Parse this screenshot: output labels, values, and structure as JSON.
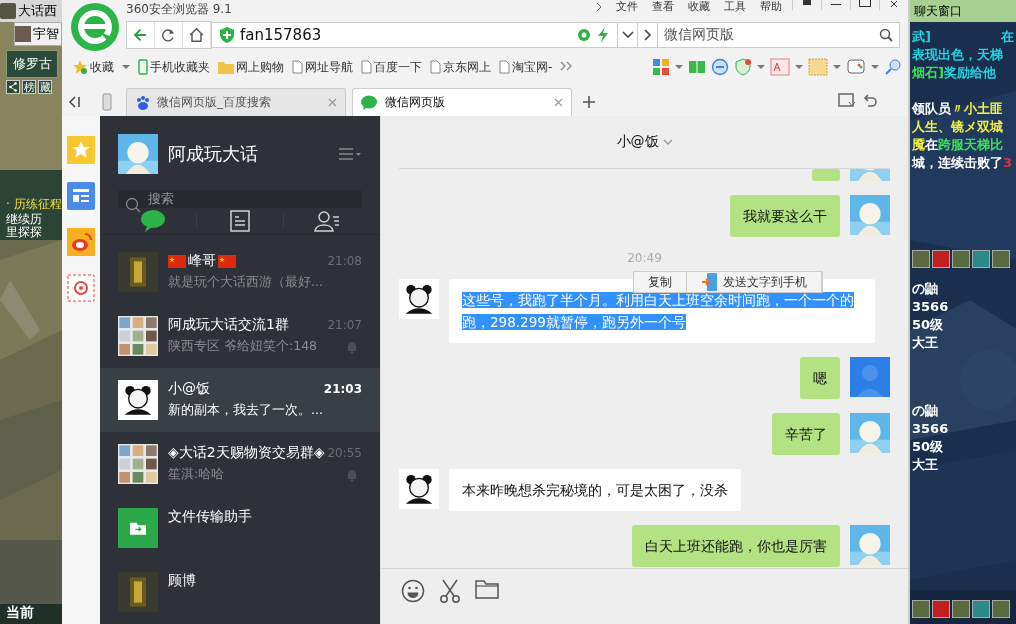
{
  "left_game": {
    "title": "大话西",
    "tab": "宇智",
    "banner": "修罗古",
    "tools": [
      "榜",
      "藏"
    ],
    "quest_title": "· 历练征程",
    "quest_lines": [
      "继续历",
      "里探探"
    ],
    "footer": "当前"
  },
  "browser": {
    "title": "360安全浏览器 9.1",
    "menu": [
      "文件",
      "查看",
      "收藏",
      "工具",
      "帮助"
    ],
    "address": "fan157863",
    "search": "微信网页版",
    "bookmarks": [
      {
        "label": "收藏",
        "kind": "favorites"
      },
      {
        "label": "手机收藏夹",
        "kind": "phone"
      },
      {
        "label": "网上购物",
        "kind": "folder"
      },
      {
        "label": "网址导航",
        "kind": "page"
      },
      {
        "label": "百度一下",
        "kind": "page"
      },
      {
        "label": "京东网上",
        "kind": "page"
      },
      {
        "label": "淘宝网-",
        "kind": "page"
      }
    ],
    "tabs": [
      {
        "label": "微信网页版_百度搜索",
        "selected": false,
        "kind": "baidu"
      },
      {
        "label": "微信网页版",
        "selected": true,
        "kind": "wechat"
      }
    ]
  },
  "wechat": {
    "user": "阿成玩大话",
    "search_placeholder": "搜索",
    "nav": [
      {
        "kind": "chat",
        "selected": true
      },
      {
        "kind": "articles",
        "selected": false
      },
      {
        "kind": "contacts",
        "selected": false
      }
    ],
    "chats": [
      {
        "name": "峰哥",
        "flags": true,
        "time": "21:08",
        "preview": "就是玩个大话西游（最好...",
        "selected": false,
        "muted": false
      },
      {
        "name": "阿成玩大话交流1群",
        "flags": false,
        "time": "21:07",
        "preview": "陕西专区 爷给妞笑个:148",
        "selected": false,
        "muted": true,
        "kind": "group"
      },
      {
        "name": "小@饭",
        "flags": false,
        "time": "21:03",
        "preview": "新的副本，我去了一次。...",
        "selected": true,
        "muted": false,
        "kind": "panda"
      },
      {
        "name": "◈大话2天赐物资交易群◈",
        "flags": false,
        "time": "20:55",
        "preview": "笙淇:哈哈",
        "selected": false,
        "muted": true,
        "kind": "group"
      },
      {
        "name": "文件传输助手",
        "flags": false,
        "selected": false,
        "muted": false,
        "kind": "file"
      },
      {
        "name": "顾博",
        "flags": false,
        "selected": false,
        "muted": false
      }
    ]
  },
  "chat": {
    "title": "小@饭",
    "messages": [
      {
        "kind": "clipped"
      },
      {
        "kind": "sent",
        "text": "我就要这么干",
        "selected": false
      },
      {
        "kind": "time",
        "text": "20:49"
      },
      {
        "kind": "received",
        "text": "这些号，我跑了半个月。利用白天上班空余时间跑，一个一个的跑，298.299就暂停，跑另外一个号",
        "selected": true
      },
      {
        "kind": "sent_loading",
        "text": "嗯",
        "selected": false
      },
      {
        "kind": "sent",
        "text": "辛苦了",
        "selected": false
      },
      {
        "kind": "received",
        "text": "本来昨晚想杀完秘境的，可是太困了，没杀",
        "selected": false
      },
      {
        "kind": "sent",
        "text": "白天上班还能跑，你也是厉害",
        "selected": false
      }
    ],
    "context_menu": [
      {
        "label": "复制",
        "kind": "copy"
      },
      {
        "label": "发送文字到手机",
        "kind": "phone"
      }
    ]
  },
  "right_game": {
    "title": "聊天窗口",
    "blocks": [
      [
        [
          {
            "text": "武]",
            "color": "#22d3e0"
          },
          {
            "text": "在",
            "color": "#22d3e0"
          }
        ],
        [
          {
            "text": "表现出色，天梯",
            "color": "#22d3e0"
          }
        ],
        [
          {
            "text": "烟石]",
            "color": "#3ee05a"
          },
          {
            "text": "奖励给他",
            "color": "#22d3e0"
          }
        ]
      ],
      [
        [
          {
            "text": "领队员",
            "color": "#ffffff"
          },
          {
            "text": "〃小土匪",
            "color": "#f0f040"
          }
        ],
        [
          {
            "text": "人生、镜メ双城",
            "color": "#f0f040"
          }
        ],
        [
          {
            "text": "魇",
            "color": "#f0f040"
          },
          {
            "text": "在",
            "color": "#ffffff"
          },
          {
            "text": "跨服天梯比",
            "color": "#3ee05a"
          }
        ],
        [
          {
            "text": "城，连续击败了",
            "color": "#ffffff"
          },
          {
            "text": "3",
            "color": "#e03040"
          }
        ]
      ],
      [
        [
          {
            "text": "の鼬",
            "color": "#ffffff"
          }
        ],
        [
          {
            "text": "3566",
            "color": "#ffffff"
          }
        ],
        [
          {
            "text": "50级",
            "color": "#ffffff"
          }
        ],
        [
          {
            "text": "大王",
            "color": "#ffffff"
          }
        ]
      ],
      [
        [
          {
            "text": "の鼬",
            "color": "#ffffff"
          }
        ],
        [
          {
            "text": "3566",
            "color": "#ffffff"
          }
        ],
        [
          {
            "text": "50级",
            "color": "#ffffff"
          }
        ],
        [
          {
            "text": "大王",
            "color": "#ffffff"
          }
        ]
      ]
    ]
  }
}
